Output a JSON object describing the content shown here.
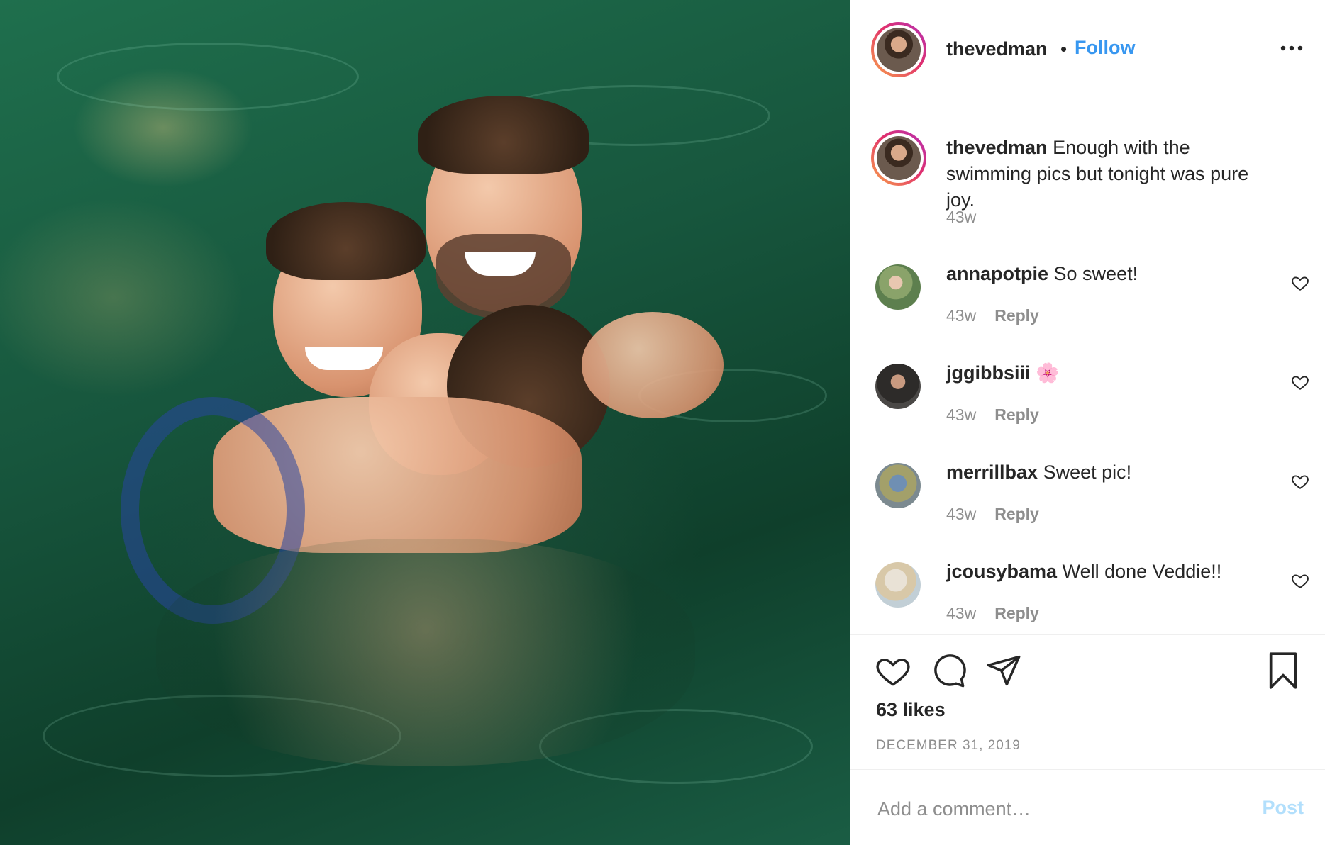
{
  "post": {
    "username": "thevedman",
    "follow_label": "Follow",
    "separator": "•",
    "more_icon": "more-horizontal-icon",
    "photo": {
      "description_icon": "photo"
    }
  },
  "caption": {
    "username": "thevedman",
    "text": "Enough with the swimming pics but tonight was pure joy.",
    "time": "43w"
  },
  "comments": [
    {
      "username": "annapotpie",
      "text": "So sweet!",
      "time": "43w",
      "reply": "Reply"
    },
    {
      "username": "jggibbsiii",
      "text": "🌸",
      "time": "43w",
      "reply": "Reply"
    },
    {
      "username": "merrillbax",
      "text": "Sweet pic!",
      "time": "43w",
      "reply": "Reply"
    },
    {
      "username": "jcousybama",
      "text": "Well done Veddie!!",
      "time": "43w",
      "reply": "Reply"
    }
  ],
  "actions": {
    "like_icon": "heart-icon",
    "comment_icon": "comment-icon",
    "share_icon": "share-icon",
    "save_icon": "bookmark-icon",
    "likes": "63 likes",
    "date": "DECEMBER 31, 2019"
  },
  "composer": {
    "placeholder": "Add a comment…",
    "post_label": "Post"
  },
  "colors": {
    "link": "#3897f0",
    "muted": "#8e8e8e",
    "post_disabled": "#b2dffc"
  }
}
